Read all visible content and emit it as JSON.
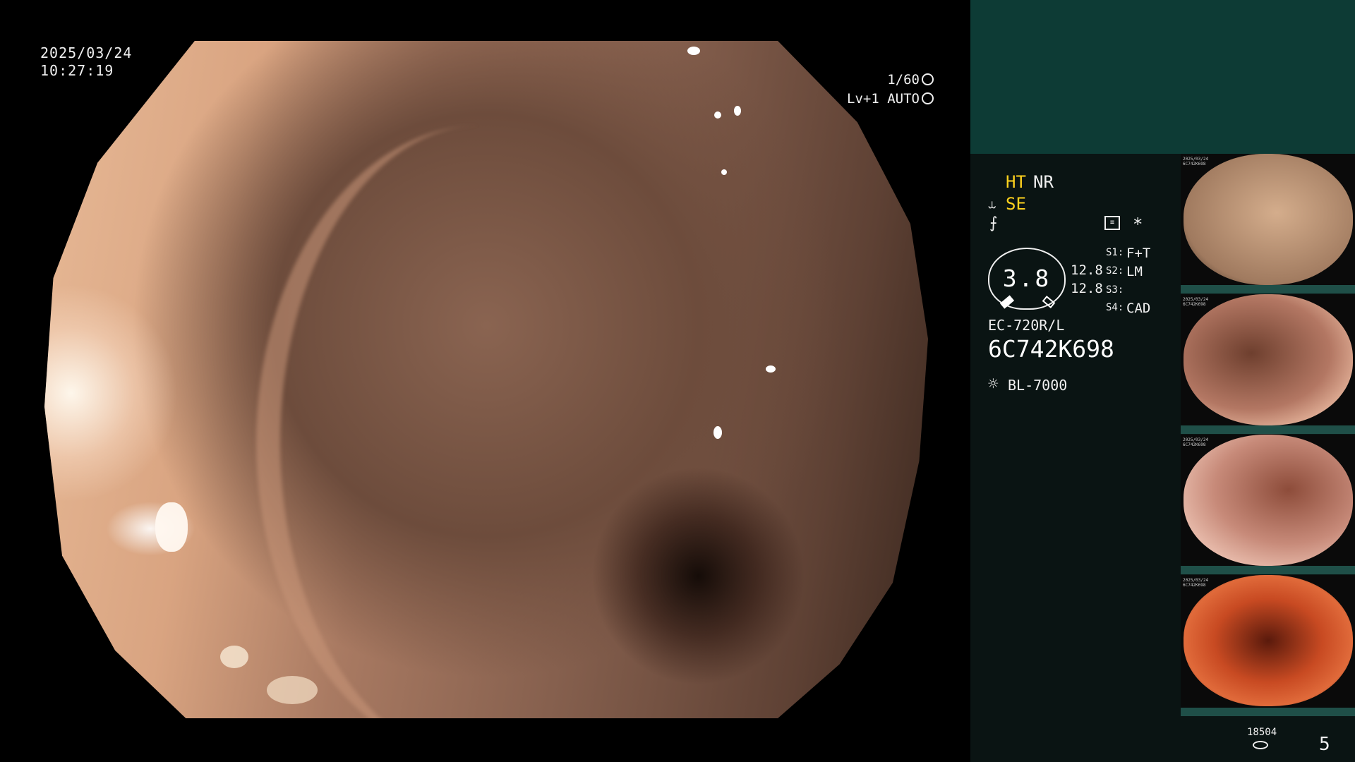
{
  "overlay": {
    "date": "2025/03/24",
    "time": "10:27:19",
    "shutter": "1/60",
    "level": "Lv+1",
    "mode": "AUTO"
  },
  "panel": {
    "ht": "HT",
    "nr": "NR",
    "se": "SE",
    "gauge_value": "3.8",
    "value_top": "12.8",
    "value_bottom": "12.8",
    "s1_label": "S1:",
    "s1_value": "F+T",
    "s2_label": "S2:",
    "s2_value": "LM",
    "s3_label": "S3:",
    "s3_value": "",
    "s4_label": "S4:",
    "s4_value": "CAD",
    "scope_model": "EC-720R/L",
    "serial": "6C742K698",
    "light_source": "BL-7000",
    "counter_top": "18504",
    "counter_right": "5"
  },
  "thumbnails": [
    {
      "cap1": "2025/03/24",
      "cap2": "6C742K698",
      "color": "#c9a07e"
    },
    {
      "cap1": "2025/03/24",
      "cap2": "6C742K698",
      "color": "#a36750"
    },
    {
      "cap1": "2025/03/24",
      "cap2": "6C742K698",
      "color": "#c88b79"
    },
    {
      "cap1": "2025/03/24",
      "cap2": "6C742K698",
      "color": "#c0401c"
    }
  ],
  "icons": [
    "shutter-icon",
    "auto-icon",
    "settings-icon",
    "asterisk-icon",
    "light-icon",
    "storage-icon"
  ]
}
